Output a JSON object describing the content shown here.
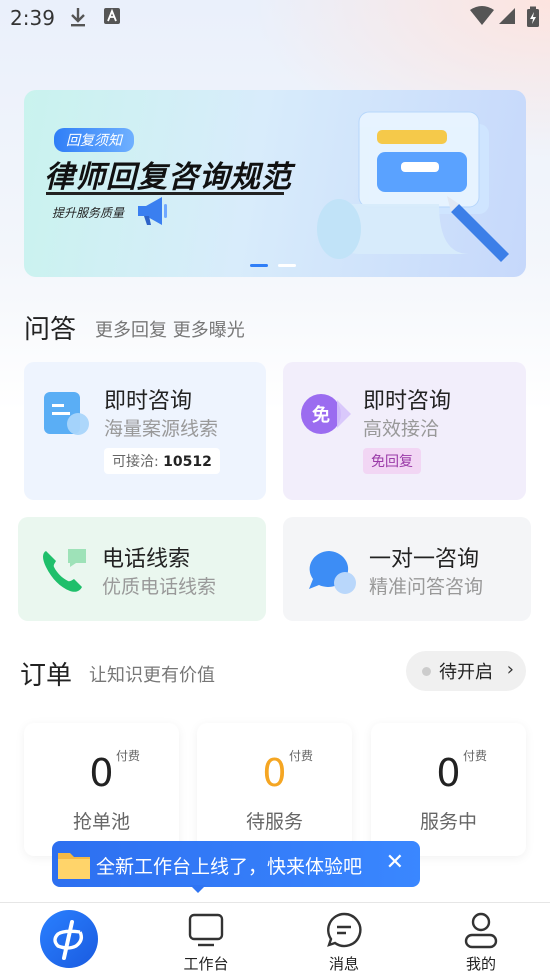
{
  "status_bar": {
    "time": "2:39"
  },
  "banner": {
    "tag": "回复须知",
    "title": "律师回复咨询规范",
    "subtitle": "提升服务质量"
  },
  "qa": {
    "title": "问答",
    "subtitle": "更多回复 更多曝光",
    "cards": [
      {
        "title": "即时咨询",
        "subtitle": "海量案源线索",
        "badge_label": "可接洽: ",
        "badge_value": "10512"
      },
      {
        "title": "即时咨询",
        "subtitle": "高效接洽",
        "badge": "免回复",
        "icon_text": "免"
      },
      {
        "title": "电话线索",
        "subtitle": "优质电话线索"
      },
      {
        "title": "一对一咨询",
        "subtitle": "精准问答咨询"
      }
    ]
  },
  "orders": {
    "title": "订单",
    "subtitle": "让知识更有价值",
    "status_chip": "待开启",
    "boxes": [
      {
        "count": "0",
        "fee": "付费",
        "label": "抢单池",
        "color": "#222222"
      },
      {
        "count": "0",
        "fee": "付费",
        "label": "待服务",
        "color": "#f5a623"
      },
      {
        "count": "0",
        "fee": "付费",
        "label": "服务中",
        "color": "#222222"
      }
    ]
  },
  "toast": {
    "text": "全新工作台上线了，快来体验吧",
    "close": "✕"
  },
  "nav": {
    "items": [
      {
        "label": "工作台"
      },
      {
        "label": "消息"
      },
      {
        "label": "我的"
      }
    ]
  },
  "colors": {
    "accent": "#2f7ef7",
    "orange": "#f5a623",
    "green": "#1fbf6b"
  }
}
